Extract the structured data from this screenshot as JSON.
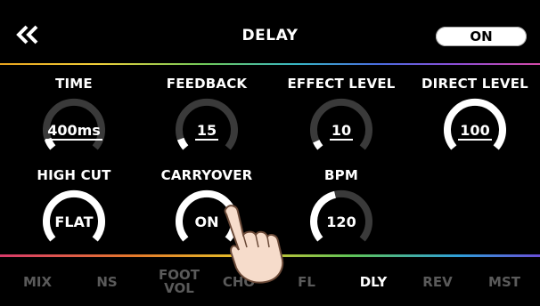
{
  "header": {
    "back_icon": "double-chevron-left-icon",
    "title": "DELAY",
    "toggle_label": "ON"
  },
  "knobs": [
    {
      "label": "TIME",
      "value": "400ms",
      "level": 0.08,
      "underline": true
    },
    {
      "label": "FEEDBACK",
      "value": "15",
      "level": 0.08,
      "underline": true
    },
    {
      "label": "EFFECT LEVEL",
      "value": "10",
      "level": 0.06,
      "underline": true
    },
    {
      "label": "DIRECT LEVEL",
      "value": "100",
      "level": 1.0,
      "underline": true
    },
    {
      "label": "HIGH CUT",
      "value": "FLAT",
      "level": 1.0,
      "underline": false
    },
    {
      "label": "CARRYOVER",
      "value": "ON",
      "level": 1.0,
      "underline": false
    },
    {
      "label": "BPM",
      "value": "120",
      "level": 0.45,
      "underline": false
    }
  ],
  "nav": [
    {
      "label": "MIX",
      "active": false
    },
    {
      "label": "NS",
      "active": false
    },
    {
      "label": "FOOT\nVOL",
      "active": false
    },
    {
      "label": "CHO",
      "active": false
    },
    {
      "label": "FL",
      "active": false
    },
    {
      "label": "DLY",
      "active": true
    },
    {
      "label": "REV",
      "active": false
    },
    {
      "label": "MST",
      "active": false
    }
  ],
  "colors": {
    "accent": "#ffffff",
    "inactive": "#5a5a5a",
    "knob_track": "#3a3a3a"
  }
}
